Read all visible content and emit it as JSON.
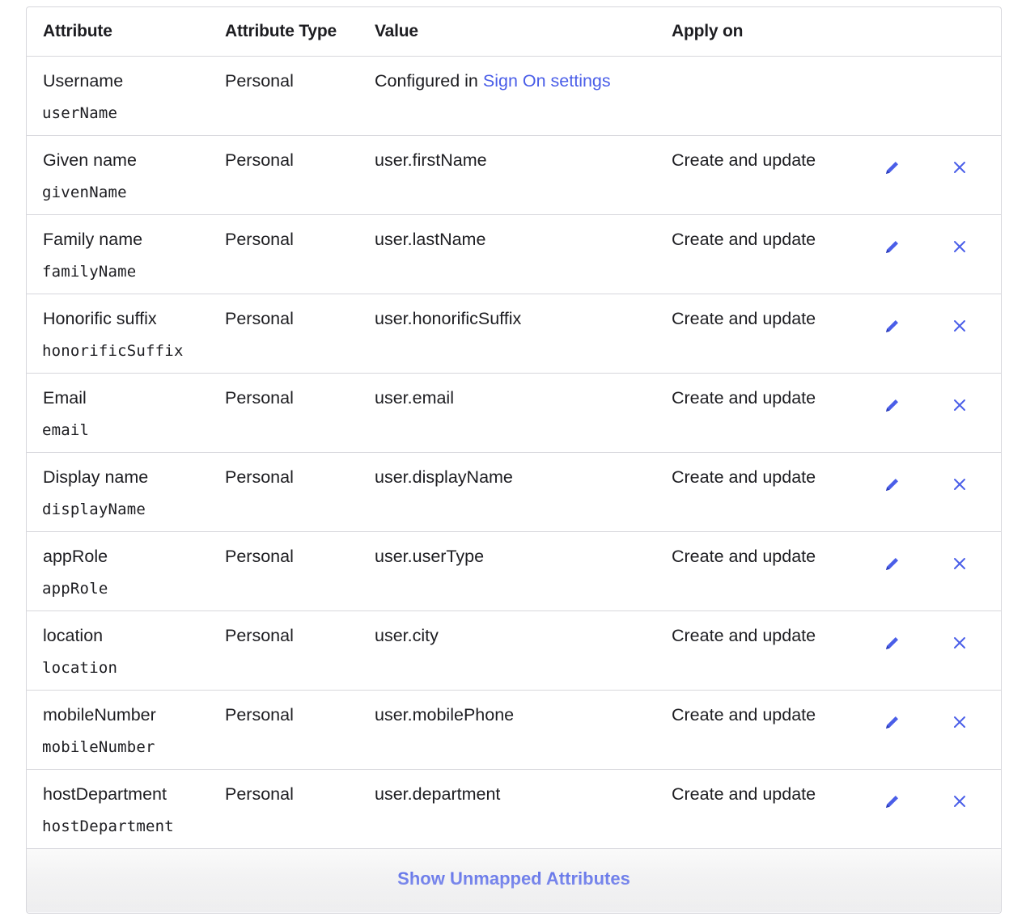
{
  "header": {
    "attribute": "Attribute",
    "attribute_type": "Attribute Type",
    "value": "Value",
    "apply_on": "Apply on"
  },
  "rows": [
    {
      "name": "Username",
      "code": "userName",
      "type": "Personal",
      "value_prefix": "Configured in ",
      "value_link": "Sign On settings",
      "value": "",
      "apply_on": "",
      "editable": false
    },
    {
      "name": "Given name",
      "code": "givenName",
      "type": "Personal",
      "value": "user.firstName",
      "apply_on": "Create and update",
      "editable": true
    },
    {
      "name": "Family name",
      "code": "familyName",
      "type": "Personal",
      "value": "user.lastName",
      "apply_on": "Create and update",
      "editable": true
    },
    {
      "name": "Honorific suffix",
      "code": "honorificSuffix",
      "type": "Personal",
      "value": "user.honorificSuffix",
      "apply_on": "Create and update",
      "editable": true
    },
    {
      "name": "Email",
      "code": "email",
      "type": "Personal",
      "value": "user.email",
      "apply_on": "Create and update",
      "editable": true
    },
    {
      "name": "Display name",
      "code": "displayName",
      "type": "Personal",
      "value": "user.displayName",
      "apply_on": "Create and update",
      "editable": true
    },
    {
      "name": "appRole",
      "code": "appRole",
      "type": "Personal",
      "value": "user.userType",
      "apply_on": "Create and update",
      "editable": true
    },
    {
      "name": "location",
      "code": "location",
      "type": "Personal",
      "value": "user.city",
      "apply_on": "Create and update",
      "editable": true
    },
    {
      "name": "mobileNumber",
      "code": "mobileNumber",
      "type": "Personal",
      "value": "user.mobilePhone",
      "apply_on": "Create and update",
      "editable": true
    },
    {
      "name": "hostDepartment",
      "code": "hostDepartment",
      "type": "Personal",
      "value": "user.department",
      "apply_on": "Create and update",
      "editable": true
    }
  ],
  "footer": {
    "show_unmapped_label": "Show Unmapped Attributes"
  },
  "icons": {
    "edit": "pencil-icon",
    "delete": "close-icon"
  },
  "colors": {
    "accent": "#4a5ee8",
    "border": "#d7d7dc",
    "text": "#1d1d21"
  }
}
